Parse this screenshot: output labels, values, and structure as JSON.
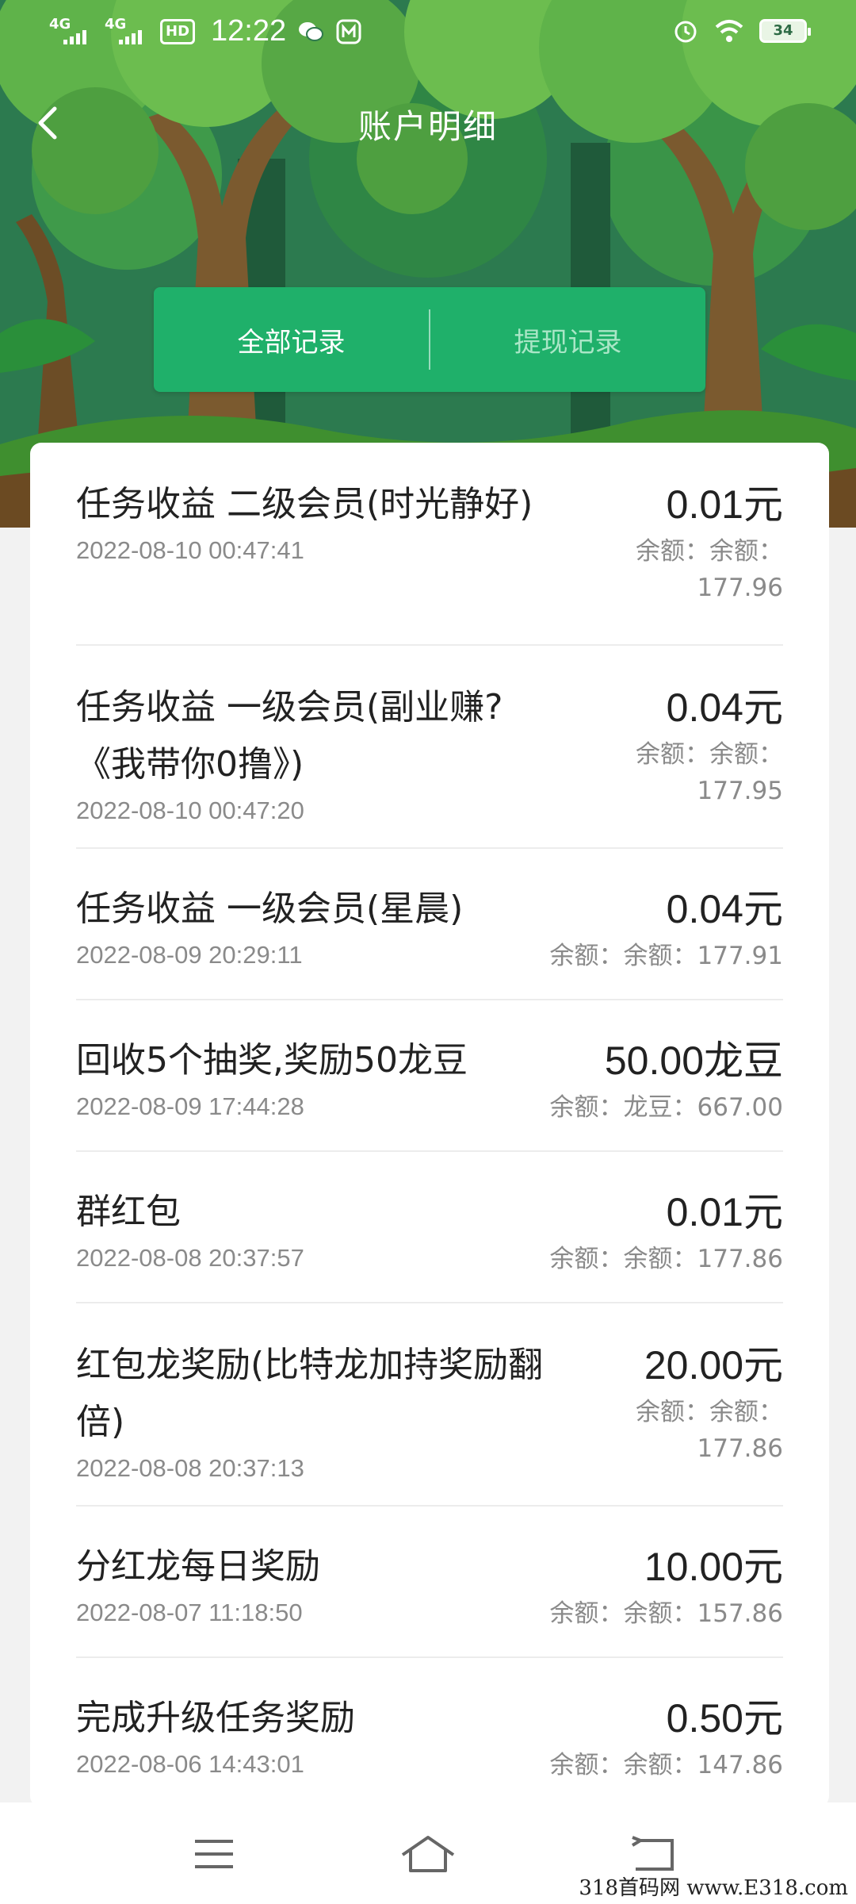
{
  "status_bar": {
    "network1": "4G",
    "network2": "4G",
    "hd_badge": "HD",
    "time": "12:22",
    "battery": "34"
  },
  "header": {
    "title": "账户明细"
  },
  "tabs": [
    {
      "label": "全部记录",
      "active": true
    },
    {
      "label": "提现记录",
      "active": false
    }
  ],
  "records": [
    {
      "title": "任务收益 二级会员(时光静好)",
      "date": "2022-08-10 00:47:41",
      "amount": "0.01元",
      "balance": "余额：余额：177.96"
    },
    {
      "title": "任务收益 一级会员(副业赚?《我带你0撸》)",
      "date": "2022-08-10 00:47:20",
      "amount": "0.04元",
      "balance": "余额：余额：177.95"
    },
    {
      "title": "任务收益 一级会员(星晨)",
      "date": "2022-08-09 20:29:11",
      "amount": "0.04元",
      "balance": "余额：余额：177.91"
    },
    {
      "title": "回收5个抽奖,奖励50龙豆",
      "date": "2022-08-09 17:44:28",
      "amount": "50.00龙豆",
      "balance": "余额：龙豆：667.00"
    },
    {
      "title": "群红包",
      "date": "2022-08-08 20:37:57",
      "amount": "0.01元",
      "balance": "余额：余额：177.86"
    },
    {
      "title": "红包龙奖励(比特龙加持奖励翻倍)",
      "date": "2022-08-08 20:37:13",
      "amount": "20.00元",
      "balance": "余额：余额：177.86"
    },
    {
      "title": "分红龙每日奖励",
      "date": "2022-08-07 11:18:50",
      "amount": "10.00元",
      "balance": "余额：余额：157.86"
    },
    {
      "title": "完成升级任务奖励",
      "date": "2022-08-06 14:43:01",
      "amount": "0.50元",
      "balance": "余额：余额：147.86"
    }
  ],
  "watermark": "318首码网 www.E318.com",
  "colors": {
    "accent": "#1fb06a",
    "forest": "#2b6f47"
  }
}
